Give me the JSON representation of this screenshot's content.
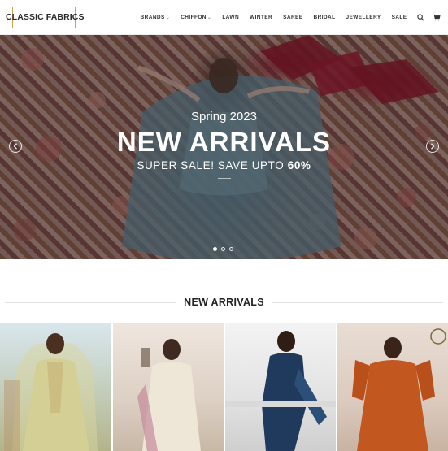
{
  "brand": {
    "name": "CLASSIC FABRICS",
    "accent": "#c9a34e"
  },
  "nav": {
    "items": [
      {
        "label": "BRANDS",
        "has_dropdown": true
      },
      {
        "label": "CHIFFON",
        "has_dropdown": true
      },
      {
        "label": "LAWN",
        "has_dropdown": false
      },
      {
        "label": "WINTER",
        "has_dropdown": false
      },
      {
        "label": "SAREE",
        "has_dropdown": false
      },
      {
        "label": "BRIDAL",
        "has_dropdown": false
      },
      {
        "label": "JEWELLERY",
        "has_dropdown": false
      },
      {
        "label": "SALE",
        "has_dropdown": false
      }
    ],
    "icons": [
      "search-icon",
      "cart-icon"
    ]
  },
  "hero": {
    "subtitle": "Spring 2023",
    "title": "NEW ARRIVALS",
    "sale_text": "SUPER SALE! SAVE UPTO",
    "sale_value": "60%",
    "slide_count": 3,
    "active_slide": 1
  },
  "section": {
    "title": "NEW ARRIVALS"
  },
  "products": [
    {
      "icon": "product-image"
    },
    {
      "icon": "product-image"
    },
    {
      "icon": "product-image"
    },
    {
      "icon": "product-image"
    }
  ]
}
